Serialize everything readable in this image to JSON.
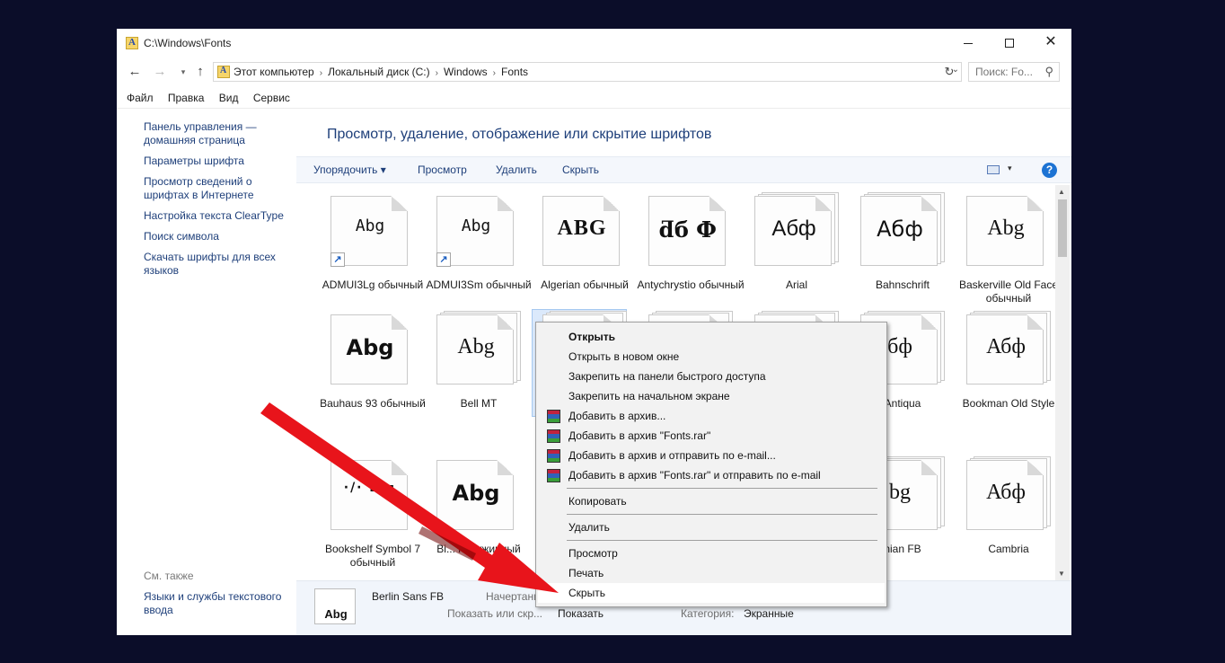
{
  "window": {
    "title": "C:\\Windows\\Fonts",
    "minimize_glyph": "",
    "close_glyph": "✕"
  },
  "nav": {
    "back_glyph": "←",
    "forward_glyph": "→",
    "recent_glyph": "▾",
    "up_glyph": "↑",
    "refresh_glyph": "↻"
  },
  "address": {
    "crumbs": [
      "Этот компьютер",
      "Локальный диск (C:)",
      "Windows",
      "Fonts"
    ],
    "separator": "›",
    "dropdown_glyph": "⌄"
  },
  "search": {
    "placeholder": "Поиск: Fo...",
    "icon": "search-icon"
  },
  "menubar": [
    "Файл",
    "Правка",
    "Вид",
    "Сервис"
  ],
  "leftpane": {
    "links": [
      "Панель управления — домашняя страница",
      "Параметры шрифта",
      "Просмотр сведений о шрифтах в Интернете",
      "Настройка текста ClearType",
      "Поиск символа",
      "Скачать шрифты для всех языков"
    ],
    "see_also": "См. также",
    "lang_link": "Языки и службы текстового ввода"
  },
  "main": {
    "heading": "Просмотр, удаление, отображение или скрытие шрифтов",
    "commands": {
      "organize": "Упорядочить",
      "organize_caret": "▾",
      "preview": "Просмотр",
      "delete": "Удалить",
      "hide": "Скрыть"
    },
    "view_caret": "▾",
    "help_glyph": "?",
    "scroll_up": "▲",
    "scroll_down": "▼"
  },
  "fonts": [
    {
      "name": "ADMUI3Lg обычный",
      "sample": "Abg",
      "stacked": false,
      "shortcut": true
    },
    {
      "name": "ADMUI3Sm обычный",
      "sample": "Abg",
      "stacked": false,
      "shortcut": true
    },
    {
      "name": "Algerian обычный",
      "sample": "ABG",
      "stacked": false,
      "shortcut": false
    },
    {
      "name": "Antychrystio обычный",
      "sample": "ƌб Ф",
      "stacked": false,
      "shortcut": false
    },
    {
      "name": "Arial",
      "sample": "Абф",
      "stacked": true,
      "shortcut": false
    },
    {
      "name": "Bahnschrift",
      "sample": "Абф",
      "stacked": true,
      "shortcut": false
    },
    {
      "name": "Baskerville Old Face обычный",
      "sample": "Abg",
      "stacked": false,
      "shortcut": false
    },
    {
      "name": "Bauhaus 93 обычный",
      "sample": "Abg",
      "stacked": false,
      "shortcut": false
    },
    {
      "name": "Bell MT",
      "sample": "Abg",
      "stacked": true,
      "shortcut": false
    },
    {
      "name": "",
      "sample": "",
      "stacked": true,
      "shortcut": false
    },
    {
      "name": "",
      "sample": "",
      "stacked": true,
      "shortcut": false
    },
    {
      "name": "",
      "sample": "",
      "stacked": true,
      "shortcut": false
    },
    {
      "name": "Antiqua",
      "sample": "бф",
      "stacked": true,
      "shortcut": false
    },
    {
      "name": "Bookman Old Style",
      "sample": "Абф",
      "stacked": true,
      "shortcut": false
    },
    {
      "name": "Bookshelf Symbol 7 обычный",
      "sample": "·/·  ▪  ▪",
      "stacked": false,
      "shortcut": false
    },
    {
      "name": "Bi... полужирный",
      "sample": "Abg",
      "stacked": false,
      "shortcut": false
    },
    {
      "name": "",
      "sample": "",
      "stacked": false,
      "shortcut": false
    },
    {
      "name": "",
      "sample": "",
      "stacked": false,
      "shortcut": false
    },
    {
      "name": "",
      "sample": "",
      "stacked": false,
      "shortcut": false
    },
    {
      "name": "nian FB",
      "sample": "bg",
      "stacked": true,
      "shortcut": false
    },
    {
      "name": "Cambria",
      "sample": "Абф",
      "stacked": true,
      "shortcut": false
    }
  ],
  "details": {
    "thumb_sample": "Abg",
    "name": "Berlin Sans FB",
    "style_label": "Начертани",
    "show_label": "Показать или скр...",
    "show_value": "Показать",
    "category_label": "Категория:",
    "category_value": "Экранные"
  },
  "context_menu": {
    "items": [
      {
        "label": "Открыть",
        "bold": true,
        "rar": false
      },
      {
        "label": "Открыть в новом окне",
        "bold": false,
        "rar": false
      },
      {
        "label": "Закрепить на панели быстрого доступа",
        "bold": false,
        "rar": false
      },
      {
        "label": "Закрепить на начальном экране",
        "bold": false,
        "rar": false
      },
      {
        "label": "Добавить в архив...",
        "bold": false,
        "rar": true
      },
      {
        "label": "Добавить в архив \"Fonts.rar\"",
        "bold": false,
        "rar": true
      },
      {
        "label": "Добавить в архив и отправить по e-mail...",
        "bold": false,
        "rar": true
      },
      {
        "label": "Добавить в архив \"Fonts.rar\" и отправить по e-mail",
        "bold": false,
        "rar": true
      },
      {
        "label": "Копировать",
        "bold": false,
        "rar": false
      },
      {
        "label": "Удалить",
        "bold": false,
        "rar": false
      },
      {
        "label": "Просмотр",
        "bold": false,
        "rar": false
      },
      {
        "label": "Печать",
        "bold": false,
        "rar": false
      },
      {
        "label": "Скрыть",
        "bold": false,
        "rar": false,
        "highlighted": true
      }
    ]
  },
  "colors": {
    "desktop": "#0b0d29",
    "link": "#1e3f7a",
    "arrow": "#e8141b",
    "help": "#1d73d3"
  }
}
